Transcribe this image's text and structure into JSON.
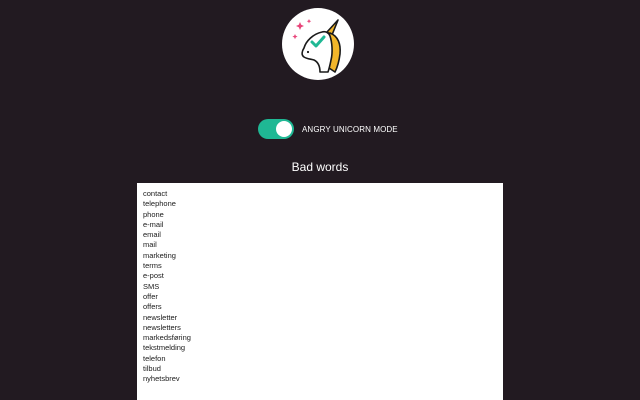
{
  "header": {
    "logo_icon": "unicorn-check-icon"
  },
  "settings": {
    "mode_label": "ANGRY UNICORN MODE",
    "mode_enabled": true,
    "accent_color": "#1fb894"
  },
  "bad_words": {
    "title": "Bad words",
    "items": [
      "contact",
      "telephone",
      "phone",
      "e-mail",
      "email",
      "mail",
      "marketing",
      "terms",
      "e-post",
      "SMS",
      "offer",
      "offers",
      "newsletter",
      "newsletters",
      "markedsføring",
      "tekstmelding",
      "telefon",
      "tilbud",
      "nyhetsbrev"
    ]
  }
}
